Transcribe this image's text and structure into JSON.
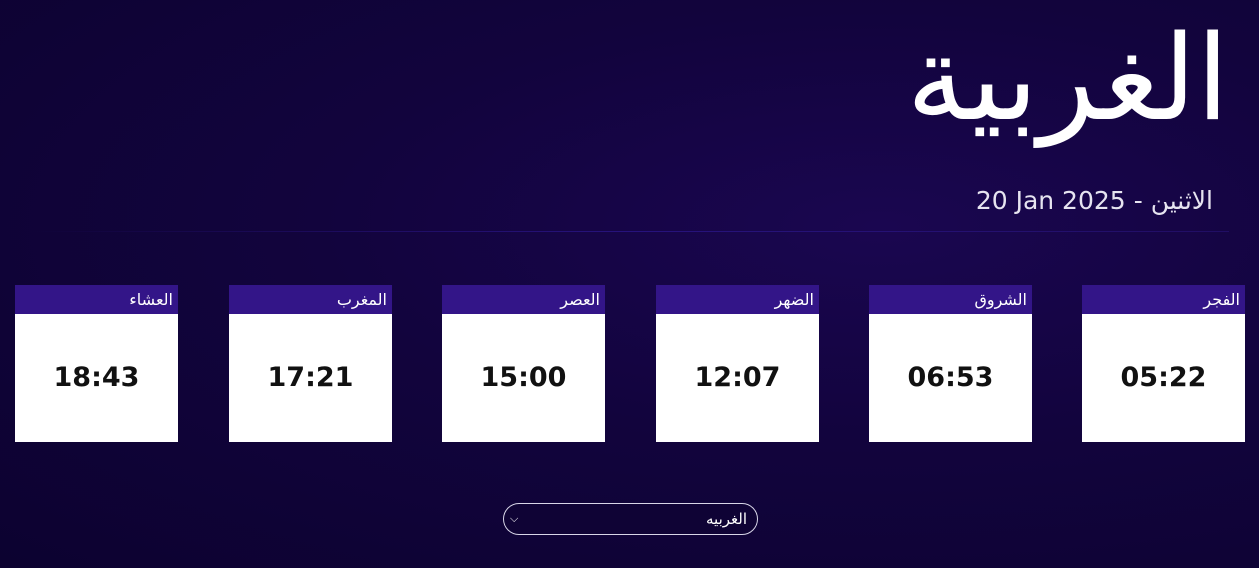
{
  "header": {
    "city_title": "الغربية",
    "date": {
      "day_name": "الاثنين",
      "separator": "-",
      "gregorian": "20 Jan 2025"
    }
  },
  "prayers": [
    {
      "name": "الفجر",
      "time": "05:22"
    },
    {
      "name": "الشروق",
      "time": "06:53"
    },
    {
      "name": "الضهر",
      "time": "12:07"
    },
    {
      "name": "العصر",
      "time": "15:00"
    },
    {
      "name": "المغرب",
      "time": "17:21"
    },
    {
      "name": "العشاء",
      "time": "18:43"
    }
  ],
  "city_select": {
    "selected": "الغربيه",
    "chevron_icon": "chevron-down-icon"
  },
  "colors": {
    "background": "#12043d",
    "card_header": "#331588",
    "card_body": "#ffffff",
    "time_text": "#111111"
  }
}
